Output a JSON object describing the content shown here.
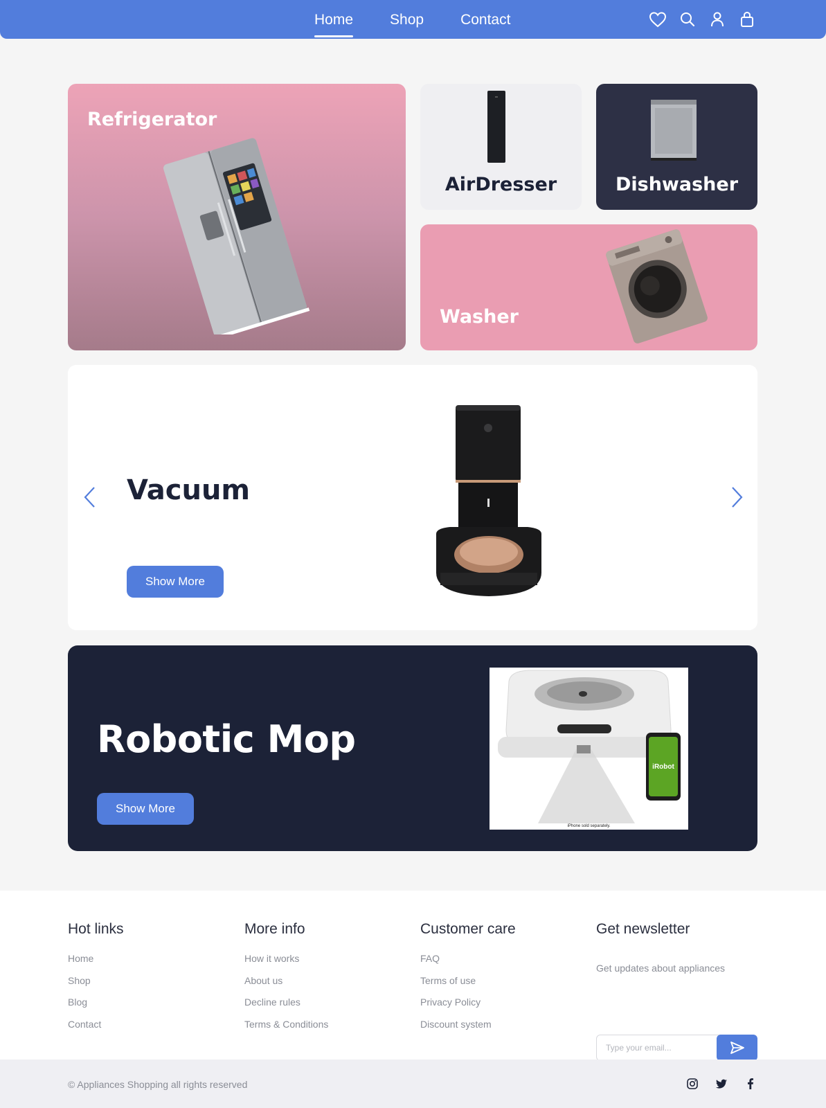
{
  "nav": {
    "items": [
      {
        "label": "Home",
        "active": true
      },
      {
        "label": "Shop",
        "active": false
      },
      {
        "label": "Contact",
        "active": false
      }
    ],
    "icons": [
      "heart-icon",
      "search-icon",
      "user-icon",
      "bag-icon"
    ]
  },
  "categories": {
    "refrigerator": "Refrigerator",
    "airdresser": "AirDresser",
    "dishwasher": "Dishwasher",
    "washer": "Washer"
  },
  "slider": {
    "title": "Vacuum",
    "button": "Show More"
  },
  "mop": {
    "title": "Robotic Mop",
    "button": "Show More",
    "image_caption": "iPhone sold separately.",
    "phone_logo": "iRobot"
  },
  "footer": {
    "hot_links": {
      "title": "Hot links",
      "items": [
        "Home",
        "Shop",
        "Blog",
        "Contact"
      ]
    },
    "more_info": {
      "title": "More info",
      "items": [
        "How it works",
        "About us",
        "Decline rules",
        "Terms & Conditions"
      ]
    },
    "customer_care": {
      "title": "Customer care",
      "items": [
        "FAQ",
        "Terms of use",
        "Privacy Policy",
        "Discount system"
      ]
    },
    "newsletter": {
      "title": "Get newsletter",
      "text": "Get updates about appliances",
      "placeholder": "Type your email..."
    },
    "copyright": "© Appliances Shopping all rights reserved",
    "social": [
      "instagram-icon",
      "twitter-icon",
      "facebook-icon"
    ]
  },
  "colors": {
    "primary": "#527ddc",
    "dark": "#1c2237",
    "pink": "#ea9db2",
    "background": "#f5f5f5"
  }
}
